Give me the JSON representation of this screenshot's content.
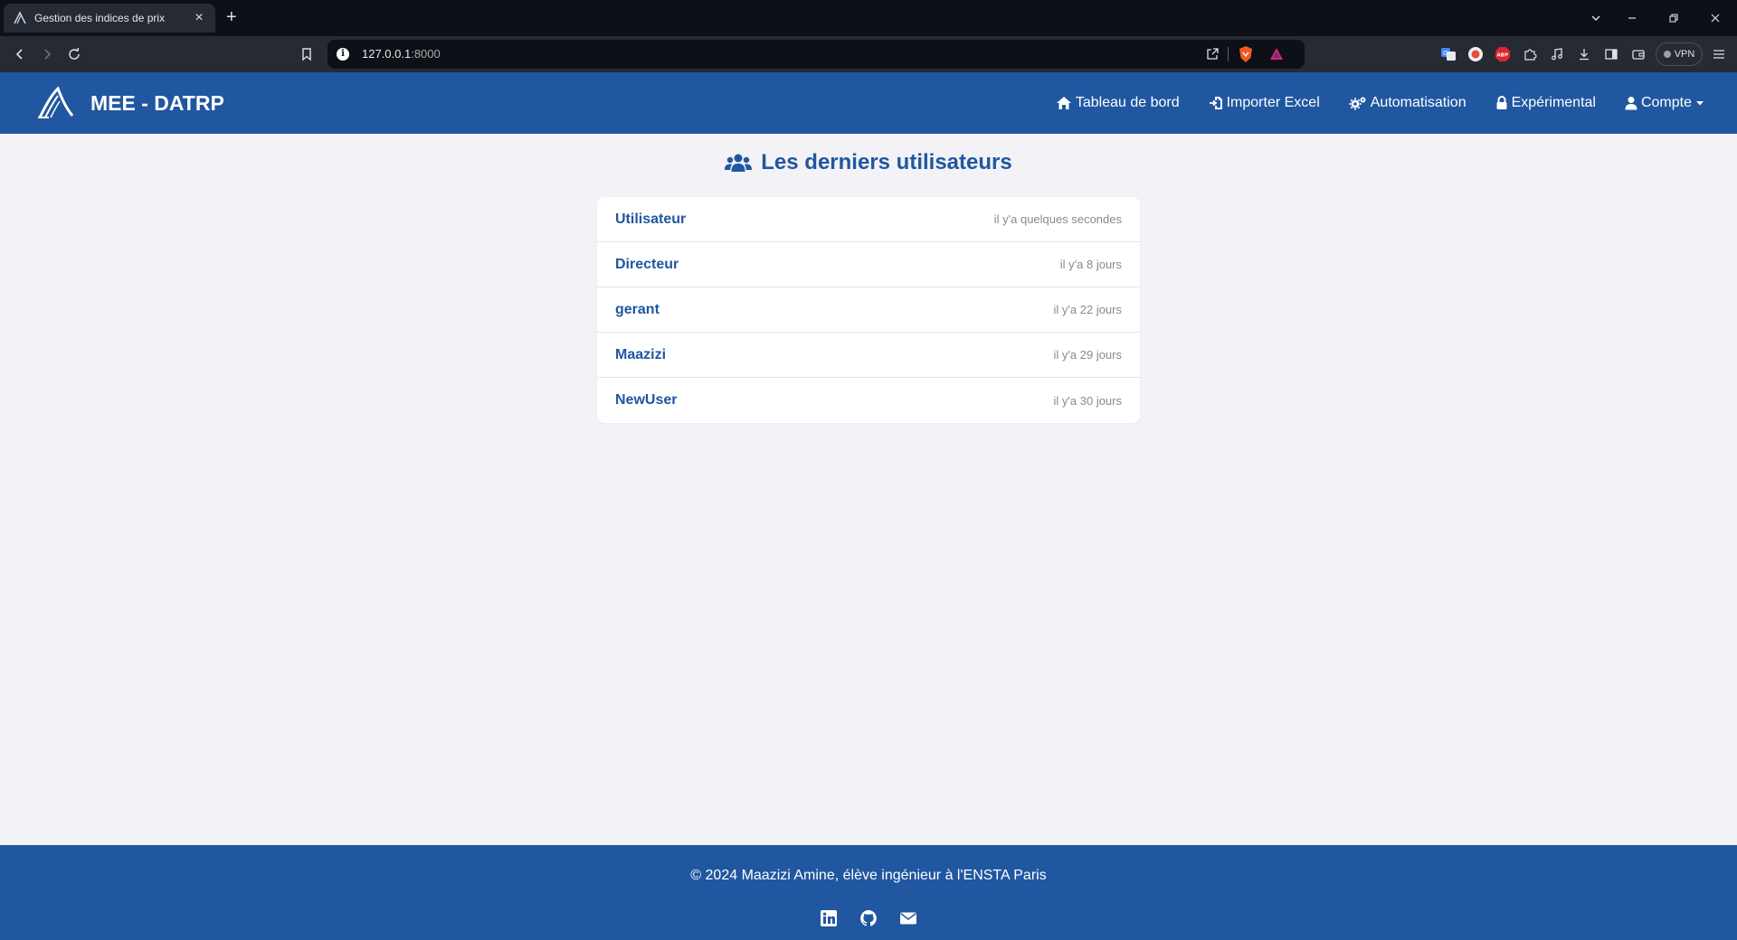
{
  "browser": {
    "tab_title": "Gestion des indices de prix",
    "url_host": "127.0.0.1",
    "url_port": ":8000",
    "vpn_label": "VPN"
  },
  "app": {
    "brand": "MEE - DATRP",
    "nav": {
      "dashboard": "Tableau de bord",
      "import_excel": "Importer Excel",
      "automation": "Automatisation",
      "experimental": "Expérimental",
      "account": "Compte"
    }
  },
  "main": {
    "heading": "Les derniers utilisateurs",
    "users": [
      {
        "name": "Utilisateur",
        "time": "il y'a quelques secondes"
      },
      {
        "name": "Directeur",
        "time": "il y'a 8 jours"
      },
      {
        "name": "gerant",
        "time": "il y'a 22 jours"
      },
      {
        "name": "Maazizi",
        "time": "il y'a 29 jours"
      },
      {
        "name": "NewUser",
        "time": "il y'a 30 jours"
      }
    ]
  },
  "footer": {
    "copyright": "© 2024 Maazizi Amine, élève ingénieur à l'ENSTA Paris"
  },
  "colors": {
    "primary": "#2057a0",
    "page_bg": "#f3f2f7",
    "chrome_dark": "#0d1016",
    "chrome_toolbar": "#262a33"
  },
  "icons": [
    "app-favicon",
    "close-icon",
    "plus-icon",
    "chevron-down-icon",
    "minimize-icon",
    "restore-icon",
    "window-close-icon",
    "back-icon",
    "forward-icon",
    "reload-icon",
    "bookmark-icon",
    "info-icon",
    "share-icon",
    "brave-shield-icon",
    "brave-rewards-icon",
    "translate-icon",
    "record-icon",
    "adblock-icon",
    "extensions-icon",
    "media-icon",
    "download-icon",
    "sidebar-icon",
    "wallet-icon",
    "menu-icon",
    "home-icon",
    "import-icon",
    "cogs-icon",
    "lock-icon",
    "user-icon",
    "caret-down-icon",
    "users-icon",
    "linkedin-icon",
    "github-icon",
    "envelope-icon"
  ]
}
